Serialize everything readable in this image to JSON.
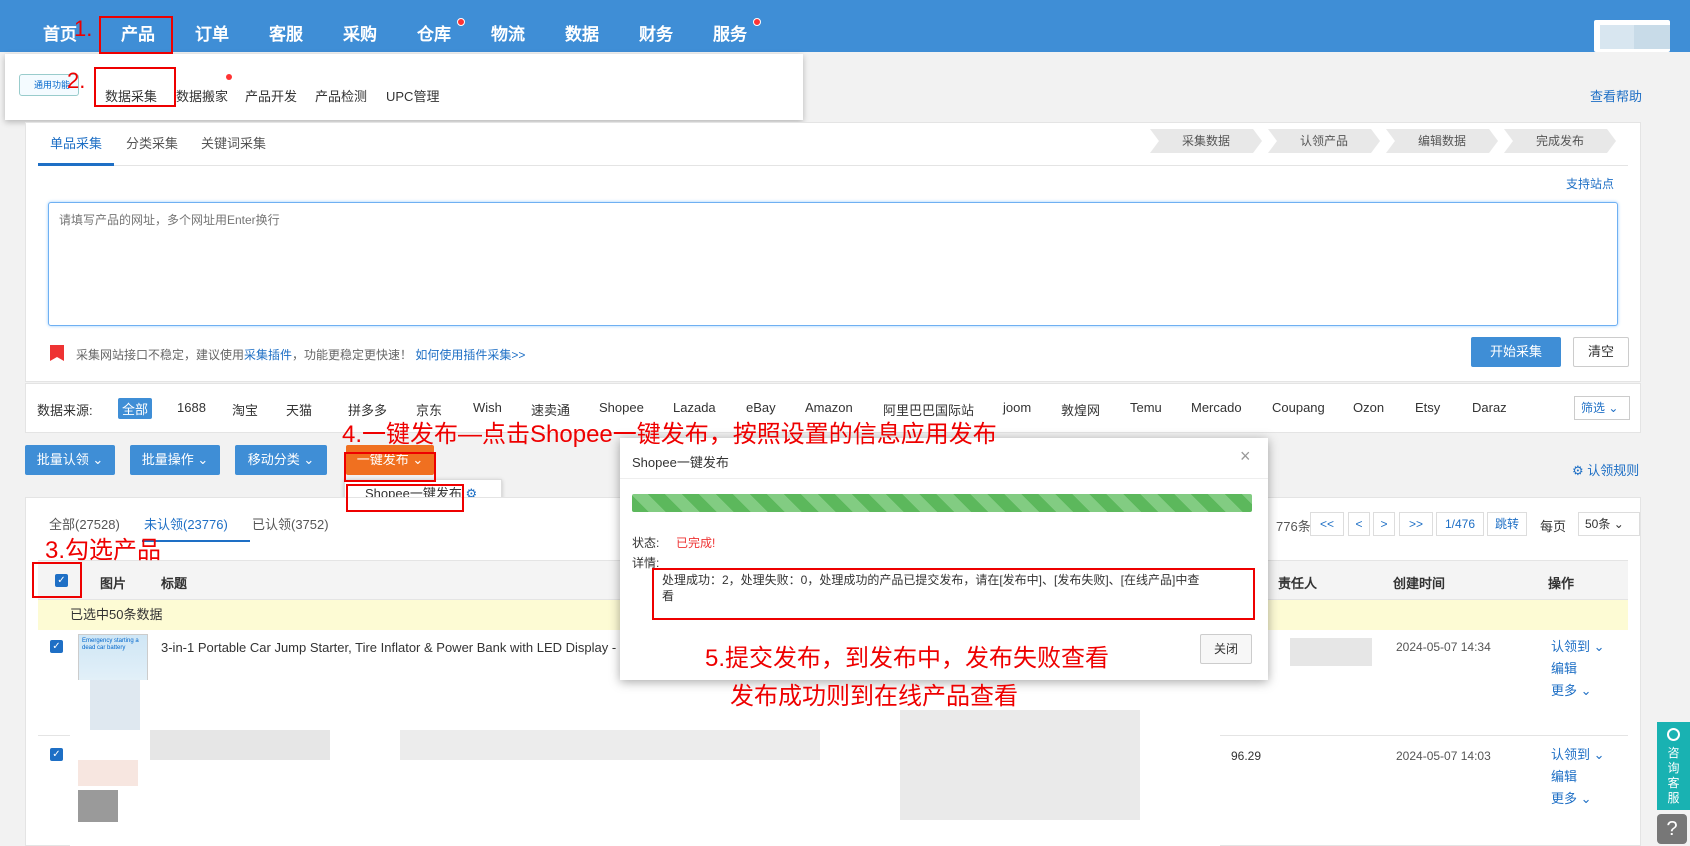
{
  "nav": {
    "items": [
      "首页",
      "产品",
      "订单",
      "客服",
      "采购",
      "仓库",
      "物流",
      "数据",
      "财务",
      "服务"
    ]
  },
  "submenu": {
    "logo_label": "通用功能",
    "items": [
      "数据采集",
      "数据搬家",
      "产品开发",
      "产品检测",
      "UPC管理"
    ]
  },
  "annotations": {
    "a1": "1.",
    "a2": "2.",
    "a3": "3.勾选产品",
    "a4": "4.一键发布—点击Shopee一键发布，按照设置的信息应用发布",
    "a5_line1": "5.提交发布，到发布中，发布失败查看",
    "a5_line2": "发布成功则到在线产品查看"
  },
  "help_link": "查看帮助",
  "collect": {
    "tabs": [
      "单品采集",
      "分类采集",
      "关键词采集"
    ],
    "steps": [
      "采集数据",
      "认领产品",
      "编辑数据",
      "完成发布"
    ],
    "support_link": "支持站点",
    "url_placeholder": "请填写产品的网址，多个网址用Enter换行",
    "notice_pre": "采集网站接口不稳定，建议使用",
    "notice_link1": "采集插件",
    "notice_mid": "，功能更稳定更快速！",
    "notice_link2": "如何使用插件采集>>",
    "start_button": "开始采集",
    "clear_button": "清空"
  },
  "sources": {
    "label": "数据来源:",
    "items": [
      "全部",
      "1688",
      "淘宝",
      "天猫",
      "拼多多",
      "京东",
      "Wish",
      "速卖通",
      "Shopee",
      "Lazada",
      "eBay",
      "Amazon",
      "阿里巴巴国际站",
      "joom",
      "敦煌网",
      "Temu",
      "Mercado",
      "Coupang",
      "Ozon",
      "Etsy",
      "Daraz"
    ],
    "filter": "筛选"
  },
  "toolbar": {
    "batch_claim": "批量认领",
    "batch_ops": "批量操作",
    "move_category": "移动分类",
    "one_click_publish": "一键发布",
    "dropdown_item": "Shopee一键发布",
    "claim_rules": "认领规则"
  },
  "list": {
    "tabs": [
      "全部(27528)",
      "未认领(23776)",
      "已认领(3752)"
    ],
    "total_suffix": "776条",
    "pager": [
      "<<",
      "<",
      ">",
      ">>",
      "1/476",
      "跳转"
    ],
    "per_page_label": "每页",
    "per_page_value": "50条",
    "columns": [
      "图片",
      "标题",
      "责任人",
      "创建时间",
      "操作"
    ],
    "selected_text": "已选中50条数据",
    "rows": [
      {
        "title": "3-in-1 Portable Car Jump Starter, Tire Inflator & Power Bank with LED Display -",
        "price": "",
        "created": "2024-05-07 14:34",
        "img_text": "Emergency starting a dead car battery"
      },
      {
        "title": "",
        "price": "96.29",
        "created": "2024-05-07 14:03",
        "img_text": ""
      }
    ],
    "row_ops": [
      "认领到",
      "编辑",
      "更多"
    ]
  },
  "modal": {
    "title": "Shopee一键发布",
    "close_x": "×",
    "status_label": "状态:",
    "status_value": "已完成!",
    "detail_label": "详情:",
    "message": "处理成功：2，处理失败：0，处理成功的产品已提交发布，请在[发布中]、[发布失败]、[在线产品]中查看",
    "close_button": "关闭"
  },
  "side": {
    "consult": "咨询客服",
    "help_icon": "?"
  },
  "icons": {
    "gear": "gear-icon",
    "chevron": "chevron-down-icon",
    "star": "bookmark-icon"
  },
  "colors": {
    "primary": "#3f8ed6",
    "publish": "#f07020",
    "annotation": "#e00000",
    "progress": "#5cb85c"
  }
}
